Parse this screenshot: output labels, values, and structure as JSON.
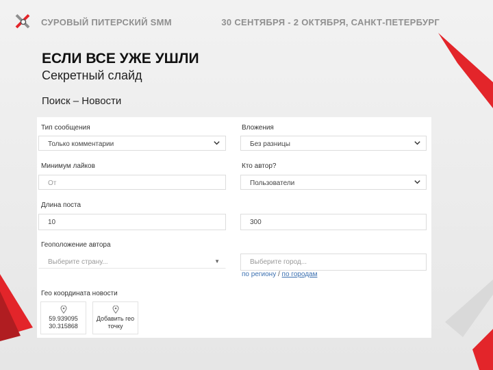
{
  "header": {
    "brand": "СУРОВЫЙ ПИТЕРСКИЙ SMM",
    "event": "30 СЕНТЯБРЯ - 2 ОКТЯБРЯ, САНКТ-ПЕТЕРБУРГ"
  },
  "slide": {
    "title": "ЕСЛИ ВСЕ УЖЕ УШЛИ",
    "subtitle": "Секретный слайд",
    "breadcrumb": "Поиск – Новости"
  },
  "form": {
    "message_type": {
      "label": "Тип сообщения",
      "value": "Только комментарии"
    },
    "attachments": {
      "label": "Вложения",
      "value": "Без разницы"
    },
    "min_likes": {
      "label": "Минимум лайков",
      "placeholder": "От"
    },
    "author": {
      "label": "Кто автор?",
      "value": "Пользователи"
    },
    "post_length": {
      "label": "Длина поста",
      "from": "10",
      "to": "300"
    },
    "author_geo": {
      "label": "Геоположение автора",
      "country_placeholder": "Выберите страну...",
      "city_placeholder": "Выберите город..."
    },
    "links": {
      "by_region": "по региону",
      "separator": "/",
      "by_city": "по городам"
    },
    "news_geo": {
      "label": "Гео координата новости",
      "coords_line1": "59.939095",
      "coords_line2": "30.315868",
      "add_line1": "Добавить гео",
      "add_line2": "точку"
    }
  },
  "colors": {
    "accent": "#e3252a",
    "brand_text": "#8f8f8f"
  }
}
